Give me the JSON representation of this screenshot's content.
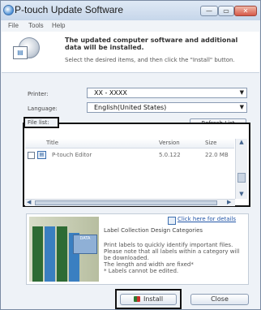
{
  "window": {
    "title": "P-touch Update Software",
    "controls": {
      "minimize": "—",
      "maximize": "▭",
      "close": "✕"
    }
  },
  "menubar": {
    "items": [
      "File",
      "Tools",
      "Help"
    ]
  },
  "header": {
    "line1": "The updated computer software and additional data will be installed.",
    "line2": "Select the desired items, and then click the \"Install\" button."
  },
  "form": {
    "printer_label": "Printer:",
    "printer_value": "XX - XXXX",
    "language_label": "Language:",
    "language_value": "English(United States)"
  },
  "file_list": {
    "label": "File list:",
    "refresh_label": "Refresh List",
    "columns": [
      "Title",
      "Version",
      "Size"
    ],
    "rows": [
      {
        "title": "P-touch Editor",
        "version": "5.0.122",
        "size": "22.0 MB"
      }
    ]
  },
  "ad": {
    "link_text": "Click here for details",
    "title": "Label Collection Design Categories",
    "body": "Print labels to quickly identify important files.\nPlease note that all labels within a category will\nbe downloaded.\nThe length and width are fixed*\n* Labels cannot be edited.",
    "image_caption": "DATA"
  },
  "buttons": {
    "install": "Install",
    "close": "Close"
  },
  "colors": {
    "title_bar": "#c6d6ea",
    "close_button": "#d6594a",
    "highlight_outline": "#111111",
    "link": "#2356a8"
  }
}
